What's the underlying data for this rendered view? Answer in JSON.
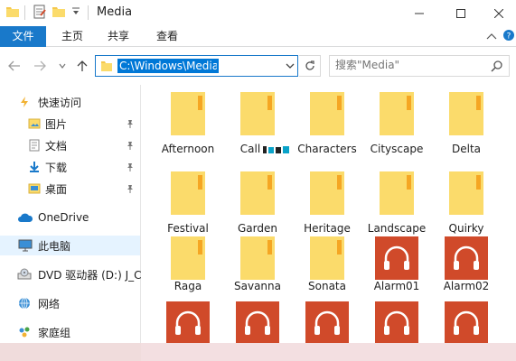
{
  "window": {
    "title": "Media"
  },
  "ribbon": {
    "tabs": [
      {
        "label": "文件"
      },
      {
        "label": "主页"
      },
      {
        "label": "共享"
      },
      {
        "label": "查看"
      }
    ]
  },
  "address": {
    "path": "C:\\Windows\\Media"
  },
  "search": {
    "placeholder": "搜索\"Media\""
  },
  "navpane": {
    "quick_access": "快速访问",
    "pinned": [
      {
        "label": "图片",
        "icon": "pictures-folder-icon"
      },
      {
        "label": "文档",
        "icon": "documents-folder-icon"
      },
      {
        "label": "下载",
        "icon": "downloads-folder-icon"
      },
      {
        "label": "桌面",
        "icon": "desktop-folder-icon"
      }
    ],
    "onedrive": "OneDrive",
    "this_pc": "此电脑",
    "dvd": "DVD 驱动器 (D:) J_C",
    "network": "网络",
    "homegroup": "家庭组"
  },
  "content": {
    "row1": [
      "Afternoon",
      "Call",
      "Characters",
      "Cityscape",
      "Delta"
    ],
    "row2": [
      "Festival",
      "Garden",
      "Heritage",
      "Landscape",
      "Quirky"
    ],
    "row3_folders": [
      "Raga",
      "Savanna",
      "Sonata"
    ],
    "row3_files": [
      "Alarm01",
      "Alarm02"
    ]
  },
  "colors": {
    "accent": "#1979ca",
    "folder": "#fbdb6b",
    "music_tile": "#d04a2a",
    "selection": "#0078d7"
  }
}
